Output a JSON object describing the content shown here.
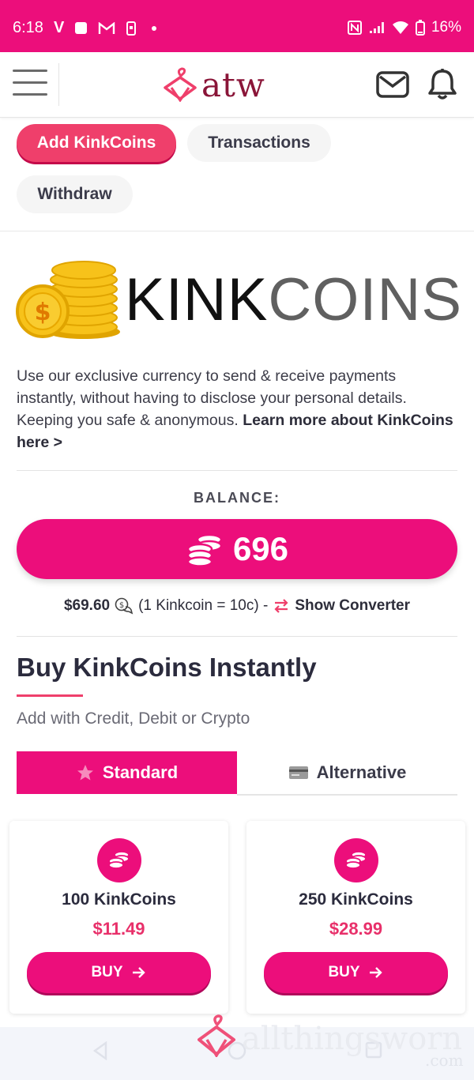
{
  "status_bar": {
    "time": "6:18",
    "carrier_icon": "V",
    "battery": "16%",
    "icons": [
      "square-icon",
      "gmail-icon",
      "phone-icon",
      "dot-icon",
      "nfc-icon",
      "signal-icon",
      "wifi-icon",
      "battery-icon"
    ]
  },
  "header": {
    "logo_text": "atw",
    "icons": [
      "menu-icon",
      "hanger-logo-icon",
      "mail-icon",
      "bell-icon"
    ]
  },
  "tabs": [
    {
      "label": "Add KinkCoins",
      "active": true
    },
    {
      "label": "Transactions",
      "active": false
    },
    {
      "label": "Withdraw",
      "active": false
    }
  ],
  "brand": {
    "kink": "KINK",
    "coins": "COINS"
  },
  "description": {
    "text": "Use our exclusive currency to send & receive payments instantly, without having to disclose your personal details. Keeping you safe & anonymous.",
    "link": "Learn more about KinkCoins here >"
  },
  "balance": {
    "label": "BALANCE:",
    "coins": "696",
    "usd": "$69.60",
    "rate": "(1 Kinkcoin = 10c) -",
    "converter": "Show Converter"
  },
  "buy": {
    "heading": "Buy KinkCoins Instantly",
    "subheading": "Add with Credit, Debit or Crypto",
    "tabs": [
      {
        "label": "Standard",
        "icon": "star-icon",
        "active": true
      },
      {
        "label": "Alternative",
        "icon": "card-icon",
        "active": false
      }
    ],
    "packages": [
      {
        "name": "100 KinkCoins",
        "price": "$11.49",
        "button": "BUY"
      },
      {
        "name": "250 KinkCoins",
        "price": "$28.99",
        "button": "BUY"
      }
    ]
  },
  "watermark": {
    "text": "allthingsworn",
    "suffix": ".com"
  },
  "colors": {
    "brand_pink": "#ec0e7b",
    "accent_red": "#ef3f6b",
    "logo_maroon": "#8a1538",
    "coin_gold": "#f5b800"
  }
}
